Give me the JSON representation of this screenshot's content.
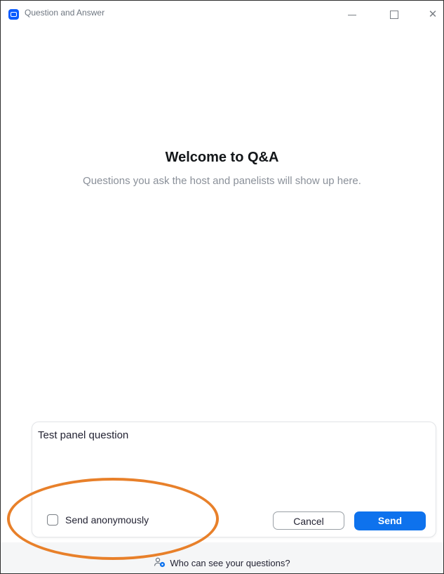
{
  "window": {
    "title": "Question and Answer",
    "controls": {
      "minimize": "–",
      "maximize": "□",
      "close": "✕"
    }
  },
  "welcome": {
    "title": "Welcome to Q&A",
    "description": "Questions you ask the host and panelists will show up here."
  },
  "composer": {
    "input_value": "Test panel question",
    "anonymous_label": "Send anonymously",
    "anonymous_checked": false,
    "cancel_label": "Cancel",
    "send_label": "Send"
  },
  "footer": {
    "visibility_label": "Who can see your questions?",
    "icon": "people-icon"
  },
  "colors": {
    "accent": "#0e72ed",
    "highlight": "#e8802a",
    "app_icon": "#0b5cff"
  }
}
